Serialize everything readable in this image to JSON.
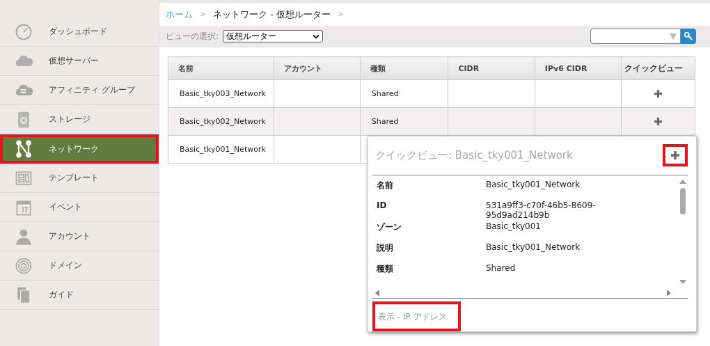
{
  "sidebar": {
    "items": [
      {
        "label": "ダッシュボード",
        "kind": "gauge",
        "selected": false,
        "highlighted": false
      },
      {
        "label": "仮想サーバー",
        "kind": "cloud",
        "selected": false,
        "highlighted": false
      },
      {
        "label": "アフィニティ グループ",
        "kind": "cloud-arrows",
        "selected": false,
        "highlighted": false
      },
      {
        "label": "ストレージ",
        "kind": "disk",
        "selected": false,
        "highlighted": false
      },
      {
        "label": "ネットワーク",
        "kind": "network",
        "selected": true,
        "highlighted": true
      },
      {
        "label": "テンプレート",
        "kind": "template",
        "selected": false,
        "highlighted": false
      },
      {
        "label": "イベント",
        "kind": "calendar",
        "selected": false,
        "highlighted": false
      },
      {
        "label": "アカウント",
        "kind": "person",
        "selected": false,
        "highlighted": false
      },
      {
        "label": "ドメイン",
        "kind": "rings",
        "selected": false,
        "highlighted": false
      },
      {
        "label": "ガイド",
        "kind": "books",
        "selected": false,
        "highlighted": false
      }
    ]
  },
  "breadcrumb": [
    {
      "label": "ホーム",
      "kind": "link"
    },
    {
      "label": "ネットワーク - 仮想ルーター",
      "kind": "current"
    }
  ],
  "breadcrumb_separator": ">",
  "toolbar": {
    "view_label": "ビューの選択:",
    "view_value": "仮想ルーター"
  },
  "table": {
    "columns": [
      "名前",
      "アカウント",
      "種類",
      "CIDR",
      "IPv6 CIDR",
      "クイックビュー"
    ],
    "rows": [
      {
        "cells": [
          "Basic_tky003_Network",
          "",
          "Shared",
          "",
          ""
        ]
      },
      {
        "cells": [
          "Basic_tky002_Network",
          "",
          "Shared",
          "",
          ""
        ]
      },
      {
        "cells": [
          "Basic_tky001_Network",
          "",
          "",
          "",
          ""
        ]
      }
    ]
  },
  "quickview": {
    "title": "クイックビュー: Basic_tky001_Network",
    "plus_highlighted": true,
    "fields": [
      {
        "label": "名前",
        "value": "Basic_tky001_Network"
      },
      {
        "label": "ID",
        "value": "531a9ff3-c70f-46b5-8609-95d9ad214b9b"
      },
      {
        "label": "ゾーン",
        "value": "Basic_tky001"
      },
      {
        "label": "説明",
        "value": "Basic_tky001_Network"
      },
      {
        "label": "種類",
        "value": "Shared"
      }
    ],
    "footer_link": "表示 - IP アドレス",
    "footer_highlighted": true
  }
}
